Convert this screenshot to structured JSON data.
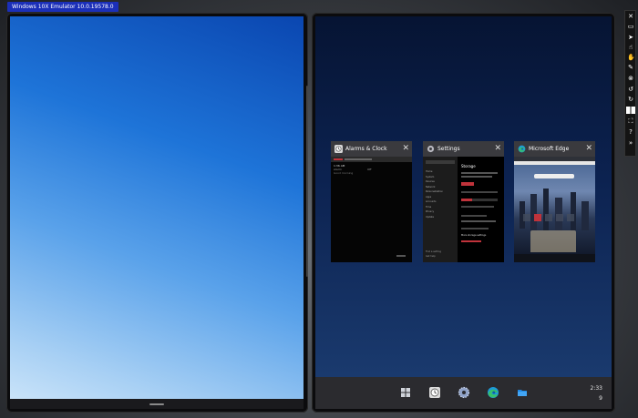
{
  "emulator": {
    "title": "Windows 10X Emulator 10.0.19578.0"
  },
  "apps": [
    {
      "name": "Alarms & Clock",
      "close": "✕"
    },
    {
      "name": "Settings",
      "close": "✕"
    },
    {
      "name": "Microsoft Edge",
      "close": "✕"
    }
  ],
  "clock_app": {
    "top_label": "1:36 AM",
    "rows": [
      "Alarm",
      "Off",
      "Good morning"
    ]
  },
  "settings_app": {
    "section": "Storage",
    "sidebar": [
      "Home",
      "System",
      "Devices",
      "Network",
      "Personalization",
      "Apps",
      "Accounts",
      "Time",
      "Privacy",
      "Update"
    ],
    "link": "More storage settings",
    "bottom": [
      "Find a setting",
      "Get help"
    ]
  },
  "taskbar": {
    "time": "2:33",
    "date": "9",
    "icons": [
      "windows-start-icon",
      "alarms-clock-icon",
      "settings-gear-icon",
      "edge-browser-icon",
      "file-explorer-icon"
    ]
  },
  "toolbar": {
    "tools": [
      "close-icon",
      "minimize-icon",
      "pointer-icon",
      "touch-icon",
      "multi-touch-icon",
      "pen-icon",
      "stop-icon",
      "rotate-left-icon",
      "rotate-right-icon",
      "dual-screen-icon",
      "fit-screen-icon",
      "help-icon",
      "more-icon"
    ]
  },
  "colors": {
    "accent": "#1b2fb8",
    "taskbar": "#2b2b2f",
    "card_header": "#3a3a3e"
  }
}
